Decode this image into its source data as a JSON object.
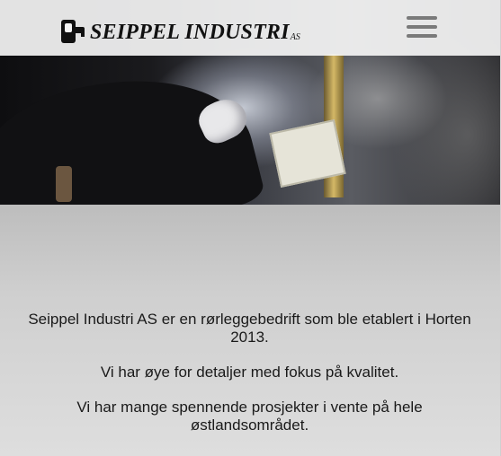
{
  "header": {
    "brand": "SEIPPEL INDUSTRI",
    "brand_suffix": "AS",
    "logo_icon": "faucet-logo-icon",
    "menu_icon": "hamburger-menu-icon"
  },
  "hero": {
    "image": "welding-workshop-photo"
  },
  "content": {
    "paragraphs": [
      "Seippel Industri AS er en rørleggebedrift som ble etablert i Horten 2013.",
      "Vi har øye for detaljer med fokus på kvalitet.",
      "Vi har mange spennende prosjekter i vente på hele østlandsområdet."
    ]
  },
  "colors": {
    "header_bg": "#f5f5f5",
    "content_bg": "#cfcfcf",
    "text": "#1a1a1a",
    "menu_icon": "#7a7a7a"
  }
}
